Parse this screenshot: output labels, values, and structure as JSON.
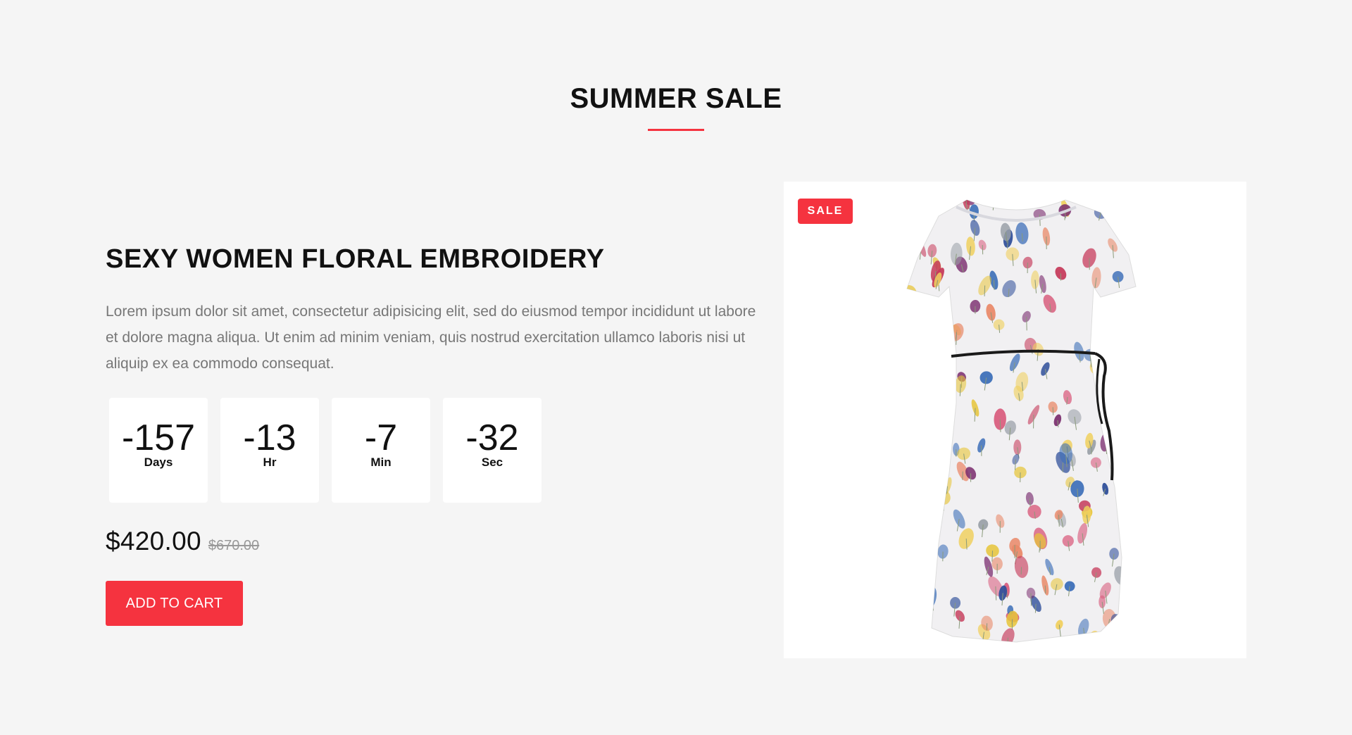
{
  "section": {
    "title": "SUMMER SALE"
  },
  "product": {
    "title": "SEXY WOMEN FLORAL EMBROIDERY",
    "description": "Lorem ipsum dolor sit amet, consectetur adipisicing elit, sed do eiusmod tempor incididunt ut labore et dolore magna aliqua. Ut enim ad minim veniam, quis nostrud exercitation ullamco laboris nisi ut aliquip ex ea commodo consequat.",
    "price": "$420.00",
    "old_price": "$670.00",
    "badge": "SALE",
    "add_to_cart": "ADD TO CART"
  },
  "countdown": [
    {
      "value": "-157",
      "label": "Days"
    },
    {
      "value": "-13",
      "label": "Hr"
    },
    {
      "value": "-7",
      "label": "Min"
    },
    {
      "value": "-32",
      "label": "Sec"
    }
  ],
  "colors": {
    "accent": "#f5333f",
    "background": "#f5f5f5",
    "card": "#ffffff"
  }
}
